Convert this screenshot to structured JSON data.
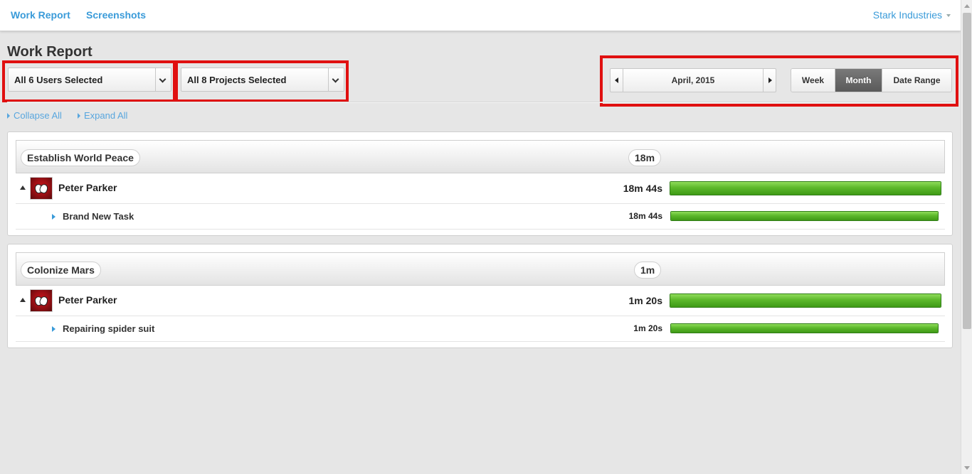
{
  "navbar": {
    "links": [
      "Work Report",
      "Screenshots"
    ],
    "organization": "Stark Industries"
  },
  "page": {
    "title": "Work Report"
  },
  "filters": {
    "users": "All 6 Users Selected",
    "projects": "All 8 Projects Selected"
  },
  "date_nav": {
    "label": "April, 2015"
  },
  "range_modes": {
    "options": [
      "Week",
      "Month",
      "Date Range"
    ],
    "selected": "Month"
  },
  "tree_controls": {
    "collapse": "Collapse All",
    "expand": "Expand All"
  },
  "projects": [
    {
      "name": "Establish World Peace",
      "total": "18m",
      "users": [
        {
          "name": "Peter Parker",
          "duration": "18m 44s",
          "progress": 1.0,
          "tasks": [
            {
              "name": "Brand New Task",
              "duration": "18m 44s",
              "progress": 1.0
            }
          ]
        }
      ]
    },
    {
      "name": "Colonize Mars",
      "total": "1m",
      "users": [
        {
          "name": "Peter Parker",
          "duration": "1m 20s",
          "progress": 1.0,
          "tasks": [
            {
              "name": "Repairing spider suit",
              "duration": "1m 20s",
              "progress": 1.0
            }
          ]
        }
      ]
    }
  ],
  "colors": {
    "link": "#3a9bd9",
    "highlight": "#e01010",
    "bar_green": "#5cb82b",
    "active_segment": "#666666"
  }
}
